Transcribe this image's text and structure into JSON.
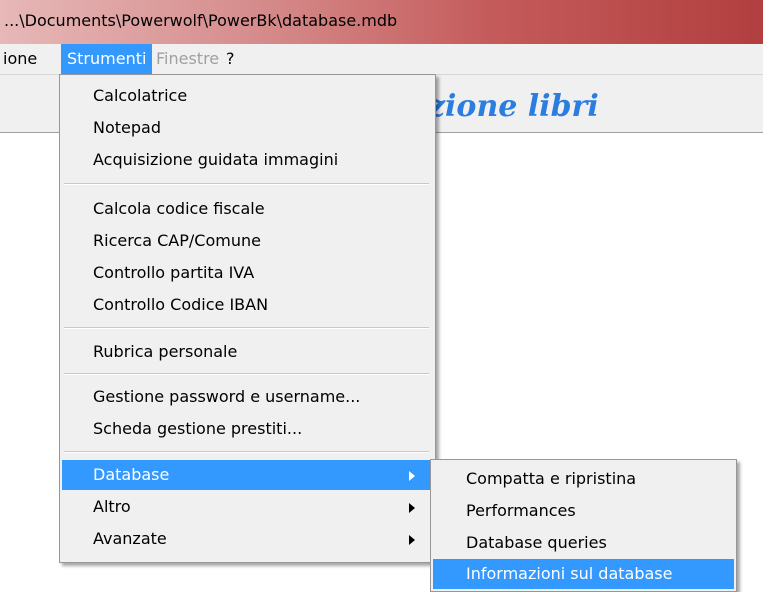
{
  "window": {
    "title": "...\\Documents\\Powerwolf\\PowerBk\\database.mdb"
  },
  "menubar": {
    "items": [
      {
        "label": "ione"
      },
      {
        "label": "Strumenti"
      },
      {
        "label": "Finestre"
      },
      {
        "label": "?"
      }
    ]
  },
  "app": {
    "title": "zione libri"
  },
  "menu": {
    "items": [
      {
        "label": "Calcolatrice"
      },
      {
        "label": "Notepad"
      },
      {
        "label": "Acquisizione guidata immagini"
      },
      {
        "label": "Calcola codice fiscale"
      },
      {
        "label": "Ricerca CAP/Comune"
      },
      {
        "label": "Controllo partita IVA"
      },
      {
        "label": "Controllo Codice IBAN"
      },
      {
        "label": "Rubrica personale"
      },
      {
        "label": "Gestione password e username..."
      },
      {
        "label": "Scheda gestione prestiti..."
      },
      {
        "label": "Database"
      },
      {
        "label": "Altro"
      },
      {
        "label": "Avanzate"
      }
    ]
  },
  "submenu": {
    "items": [
      {
        "label": "Compatta e ripristina"
      },
      {
        "label": "Performances"
      },
      {
        "label": "Database queries"
      },
      {
        "label": "Informazioni sul database"
      }
    ]
  },
  "colors": {
    "highlight": "#3399ff",
    "menu_bg": "#f0f0f0",
    "app_title": "#2b7de0"
  }
}
